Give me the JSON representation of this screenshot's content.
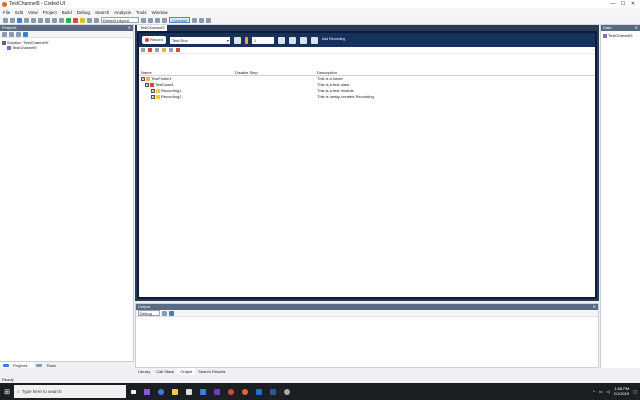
{
  "window": {
    "title": "TestChannel9 - Coded UI",
    "controls": [
      "—",
      "☐",
      "✕"
    ]
  },
  "menu": [
    "File",
    "Edit",
    "View",
    "Project",
    "Build",
    "Debug",
    "Search",
    "Analysis",
    "Tools",
    "Window"
  ],
  "toolbar": {
    "config_select": "Default Layout",
    "connect_label": "Connect"
  },
  "left_panel": {
    "title": "Projects",
    "tree": [
      {
        "label": "Solution 'TestChannel9'",
        "indent": 0,
        "icon": "solution-icon"
      },
      {
        "label": "TestChannel9",
        "indent": 1,
        "icon": "project-icon"
      }
    ],
    "tabs": [
      "Projects",
      "Tests"
    ]
  },
  "document": {
    "tab_label": "TestChannel9",
    "record_label": "Record",
    "run_select": "Test Run",
    "num_value": "1",
    "caption": "Add Recording",
    "columns": [
      "Name",
      "Disable Step",
      "Description"
    ],
    "rows": [
      {
        "name": "TestFolder1",
        "desc": "This is a folder",
        "icon": "folder",
        "indent": 0,
        "checked": true
      },
      {
        "name": "TestCase1",
        "desc": "This is a test case",
        "icon": "case",
        "indent": 1,
        "checked": true
      },
      {
        "name": "Recording1",
        "desc": "This is a test module",
        "icon": "rec",
        "indent": 2,
        "checked": true
      },
      {
        "name": "Recording2",
        "desc": "This is newly created Recording",
        "icon": "rec",
        "indent": 2,
        "checked": true
      }
    ]
  },
  "right_panel": {
    "title": "Data",
    "item": "TestChannel9"
  },
  "output": {
    "title": "Output",
    "select": "Debug"
  },
  "bottom_tabs": [
    "Library",
    "Call Stack",
    "Output",
    "Search Results"
  ],
  "status": "Ready",
  "taskbar": {
    "search_placeholder": "Type here to search",
    "time": "1:58 PM",
    "date": "2/1/2019"
  }
}
